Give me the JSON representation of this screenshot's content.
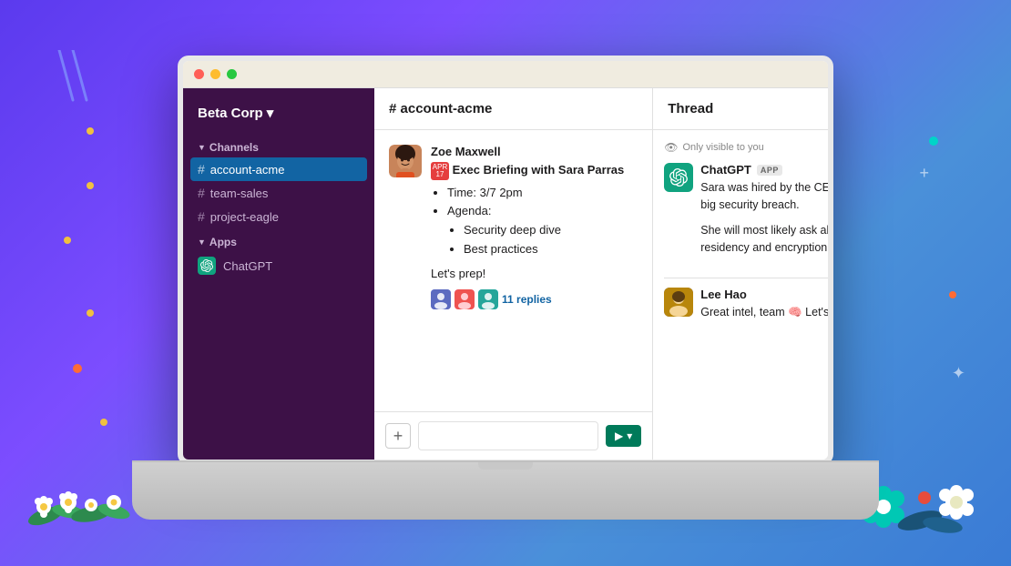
{
  "background": {
    "gradient_start": "#5b3aee",
    "gradient_end": "#3a7bd5"
  },
  "window": {
    "traffic_lights": [
      "red",
      "yellow",
      "green"
    ]
  },
  "sidebar": {
    "workspace": "Beta Corp",
    "dropdown_icon": "▾",
    "channels_label": "Channels",
    "channels": [
      {
        "name": "account-acme",
        "active": true
      },
      {
        "name": "team-sales",
        "active": false
      },
      {
        "name": "project-eagle",
        "active": false
      }
    ],
    "apps_label": "Apps",
    "apps": [
      {
        "name": "ChatGPT"
      }
    ]
  },
  "channel": {
    "header": "# account-acme",
    "message": {
      "sender": "Zoe Maxwell",
      "calendar_month": "APR",
      "calendar_day": "17",
      "title": "Exec Briefing with Sara Parras",
      "bullets": [
        {
          "text": "Time: 3/7 2pm"
        },
        {
          "text": "Agenda:",
          "sub": [
            "Security deep dive",
            "Best practices"
          ]
        }
      ],
      "footer": "Let's prep!",
      "replies_count": "11 replies"
    },
    "input_placeholder": ""
  },
  "thread": {
    "header": "Thread",
    "visibility_note": "Only visible to you",
    "chatgpt": {
      "sender": "ChatGPT",
      "badge": "APP",
      "paragraph1": "Sara was hired by the CEO after a big security breach.",
      "paragraph2": "She will most likely ask about data residency and encryption keys."
    },
    "lee": {
      "sender": "Lee Hao",
      "text": "Great intel, team 🧠 Let's do this!"
    }
  },
  "icons": {
    "plus": "+",
    "send": "▶",
    "chevron_down": "▾",
    "eye": "👁",
    "hash": "#"
  }
}
